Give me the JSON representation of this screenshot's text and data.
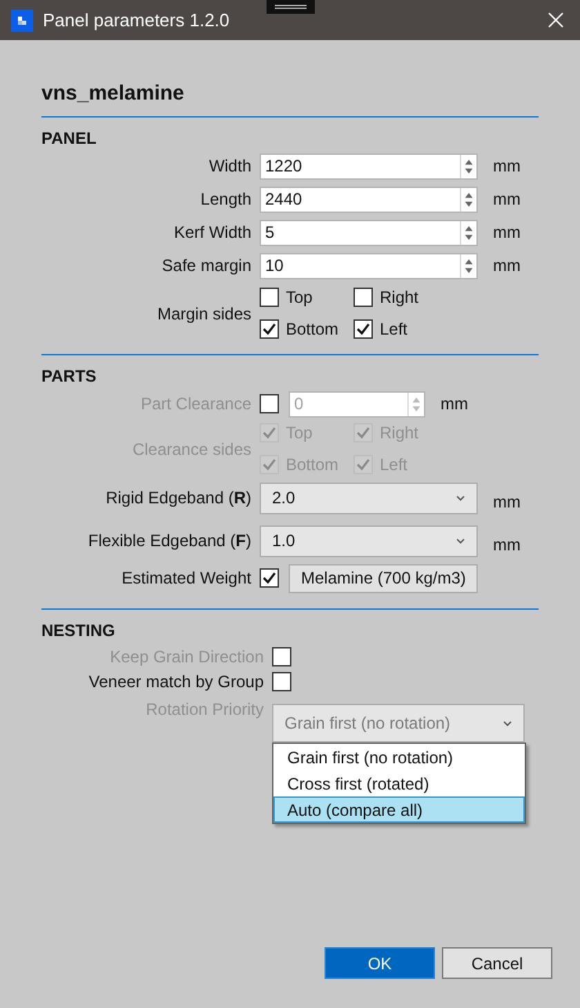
{
  "window": {
    "title": "Panel parameters 1.2.0"
  },
  "heading": "vns_melamine",
  "sections": [
    {
      "title": "PANEL",
      "rows": [
        {
          "kind": "spin",
          "label": "Width",
          "value": "1220",
          "unit": "mm",
          "disabled": false
        },
        {
          "kind": "spin",
          "label": "Length",
          "value": "2440",
          "unit": "mm",
          "disabled": false
        },
        {
          "kind": "spin",
          "label": "Kerf Width",
          "value": "5",
          "unit": "mm",
          "disabled": false
        },
        {
          "kind": "spin",
          "label": "Safe margin",
          "value": "10",
          "unit": "mm",
          "disabled": false
        },
        {
          "kind": "checks",
          "label": "Margin sides",
          "disabled": false,
          "options": [
            {
              "label": "Top",
              "checked": false
            },
            {
              "label": "Right",
              "checked": false
            },
            {
              "label": "Bottom",
              "checked": true
            },
            {
              "label": "Left",
              "checked": true
            }
          ]
        }
      ]
    },
    {
      "title": "PARTS",
      "rows": [
        {
          "kind": "checkspin",
          "label": "Part Clearance",
          "checked": false,
          "value": "0",
          "unit": "mm",
          "disabled": true
        },
        {
          "kind": "checks",
          "label": "Clearance sides",
          "disabled": true,
          "options": [
            {
              "label": "Top",
              "checked": true
            },
            {
              "label": "Right",
              "checked": true
            },
            {
              "label": "Bottom",
              "checked": true
            },
            {
              "label": "Left",
              "checked": true
            }
          ]
        },
        {
          "kind": "select",
          "label": "Rigid Edgeband (**R**)",
          "value": "2.0",
          "unit": "mm",
          "disabled": false
        },
        {
          "kind": "select",
          "label": "Flexible Edgeband (**F**)",
          "value": "1.0",
          "unit": "mm",
          "disabled": false
        },
        {
          "kind": "checkbutton",
          "label": "Estimated Weight",
          "checked": true,
          "button": "Melamine (700 kg/m3)",
          "disabled": false
        }
      ]
    },
    {
      "title": "NESTING",
      "rows": [
        {
          "kind": "check",
          "label": "Keep Grain Direction",
          "checked": false,
          "disabled": true
        },
        {
          "kind": "check",
          "label": "Veneer match by Group",
          "checked": false,
          "disabled": false
        },
        {
          "kind": "select",
          "label": "Rotation Priority",
          "value": "Grain first (no rotation)",
          "disabled": true,
          "expanded": true,
          "options": [
            {
              "label": "Grain first (no rotation)",
              "highlighted": false
            },
            {
              "label": "Cross first (rotated)",
              "highlighted": false
            },
            {
              "label": "Auto (compare all)",
              "highlighted": true
            }
          ]
        }
      ]
    }
  ],
  "buttons": [
    {
      "label": "OK",
      "primary": true
    },
    {
      "label": "Cancel",
      "primary": false
    }
  ]
}
